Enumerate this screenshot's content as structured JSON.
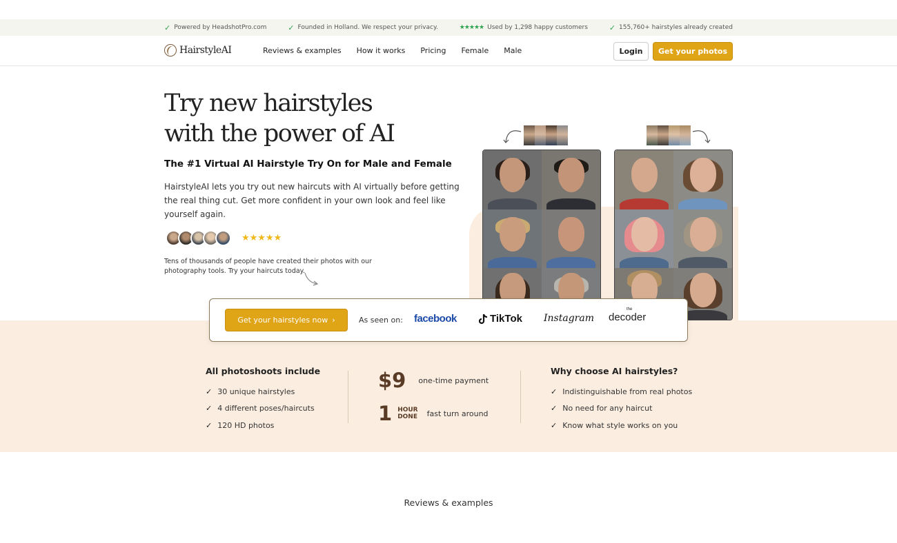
{
  "topbar": {
    "items": [
      {
        "icon": "check-icon",
        "text": "Powered by HeadshotPro.com"
      },
      {
        "icon": "check-icon",
        "text": "Founded in Holland. We respect your privacy."
      },
      {
        "icon": "stars-icon",
        "stars": "★★★★★",
        "text": "Used by 1,298 happy customers"
      },
      {
        "icon": "check-icon",
        "text": "155,760+ hairstyles already created"
      }
    ]
  },
  "nav": {
    "logo": "HairstyleAI",
    "links": [
      "Reviews & examples",
      "How it works",
      "Pricing",
      "Female",
      "Male"
    ],
    "login": "Login",
    "cta": "Get your photos"
  },
  "hero": {
    "title_line1": "Try new hairstyles",
    "title_line2": "with the power of AI",
    "subtitle": "The #1 Virtual AI Hairstyle Try On for Male and Female",
    "description": "HairstyleAI lets you try out new haircuts with AI virtually before getting the real thing cut. Get more confident in your own look and feel like yourself again.",
    "rating_stars": "★★★★★",
    "social_proof": "Tens of thousands of people have created their photos with our photography tools. Try your haircuts today."
  },
  "cta_card": {
    "button": "Get your hairstyles now",
    "button_icon": "chevron-right-icon",
    "seen_on": "As seen on:",
    "brands": [
      "facebook",
      "TikTok",
      "Instagram",
      "decoder"
    ],
    "decoder_small": "the"
  },
  "features": {
    "left": {
      "title": "All photoshoots include",
      "items": [
        "30 unique hairstyles",
        "4 different poses/haircuts",
        "120 HD photos"
      ]
    },
    "middle": {
      "price": "$9",
      "price_caption": "one-time payment",
      "hour": "1",
      "hour_label_1": "HOUR",
      "hour_label_2": "DONE",
      "hour_caption": "fast turn around"
    },
    "right": {
      "title": "Why choose AI hairstyles?",
      "items": [
        "Indistinguishable from real photos",
        "No need for any haircut",
        "Know what style works on you"
      ]
    }
  },
  "reviews_heading": "Reviews & examples",
  "colors": {
    "accent": "#e0a417",
    "section_bg": "#fbeee1",
    "check_green": "#2ea44f",
    "star_yellow": "#f1b81a",
    "price_brown": "#5a3b26"
  }
}
